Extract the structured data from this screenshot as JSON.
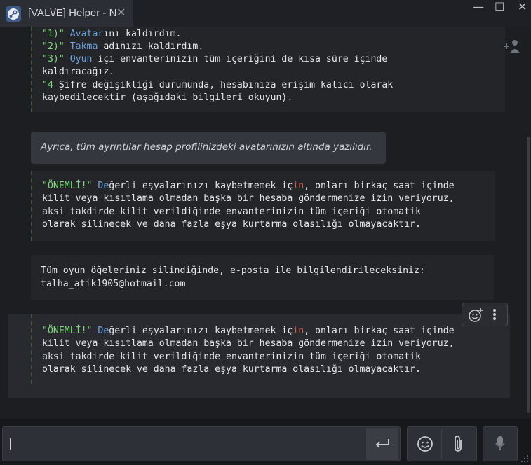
{
  "window": {
    "tab_title": "[VAL\\/E] Helper - N",
    "tab_close": "✕",
    "minimize": "—",
    "maximize": "☐",
    "close": "✕"
  },
  "chat": {
    "block1": {
      "lines": [
        {
          "quote": "\"1)\"",
          "keyword": " Avatar",
          "rest": "ını kaldırdım."
        },
        {
          "quote": "\"2)\"",
          "keyword": " Takma",
          "rest": " adınızı kaldırdım."
        },
        {
          "quote": "\"3)\"",
          "keyword": " Oyun",
          "rest": " içi envanterinizin tüm içeriğini de kısa süre içinde"
        },
        {
          "quote": "",
          "keyword": "",
          "rest": "kaldıracağız."
        },
        {
          "quote": "\"4",
          "keyword": "",
          "rest": " Şifre değişikliği durumunda, hesabınıza erişim kalıcı olarak"
        },
        {
          "quote": "",
          "keyword": "",
          "rest": "kaybedilecektir (aşağıdaki bilgileri okuyun)."
        }
      ]
    },
    "quote_text": "Ayrıca, tüm ayrıntılar hesap profilinizdeki avatarınızın altında yazılıdır.",
    "important_block": {
      "tag": "\"ÖNEMLİ!\"",
      "de": " De",
      "line1_a": "ğerli eşyalarınızı kaybetmemek iç",
      "line1_in": "in",
      "line1_b": ", onları birkaç saat içinde",
      "line2": "kilit veya kısıtlama olmadan başka bir hesaba göndermenize izin veriyoruz,",
      "line3": "aksi takdirde kilit verildiğinde envanterinizin tüm içeriği otomatik",
      "line4": "olarak silinecek ve daha fazla eşya kurtarma olasılığı olmayacaktır."
    },
    "notice_block": {
      "line1": "Tüm oyun öğeleriniz silindiğinde, e-posta ile bilgilendirileceksiniz:",
      "line2": "talha_atik1905@hotmail.com"
    }
  },
  "icons": {
    "add_friend": "add-friend-icon",
    "emoji_add": "emoji-add-icon",
    "more": "more-vertical-icon",
    "send": "enter-return-icon",
    "emoji": "smiley-icon",
    "attach": "paperclip-icon",
    "mic": "microphone-icon"
  },
  "colors": {
    "green": "#7ed67a",
    "blue": "#6fa3e0",
    "red": "#d55a4b"
  }
}
